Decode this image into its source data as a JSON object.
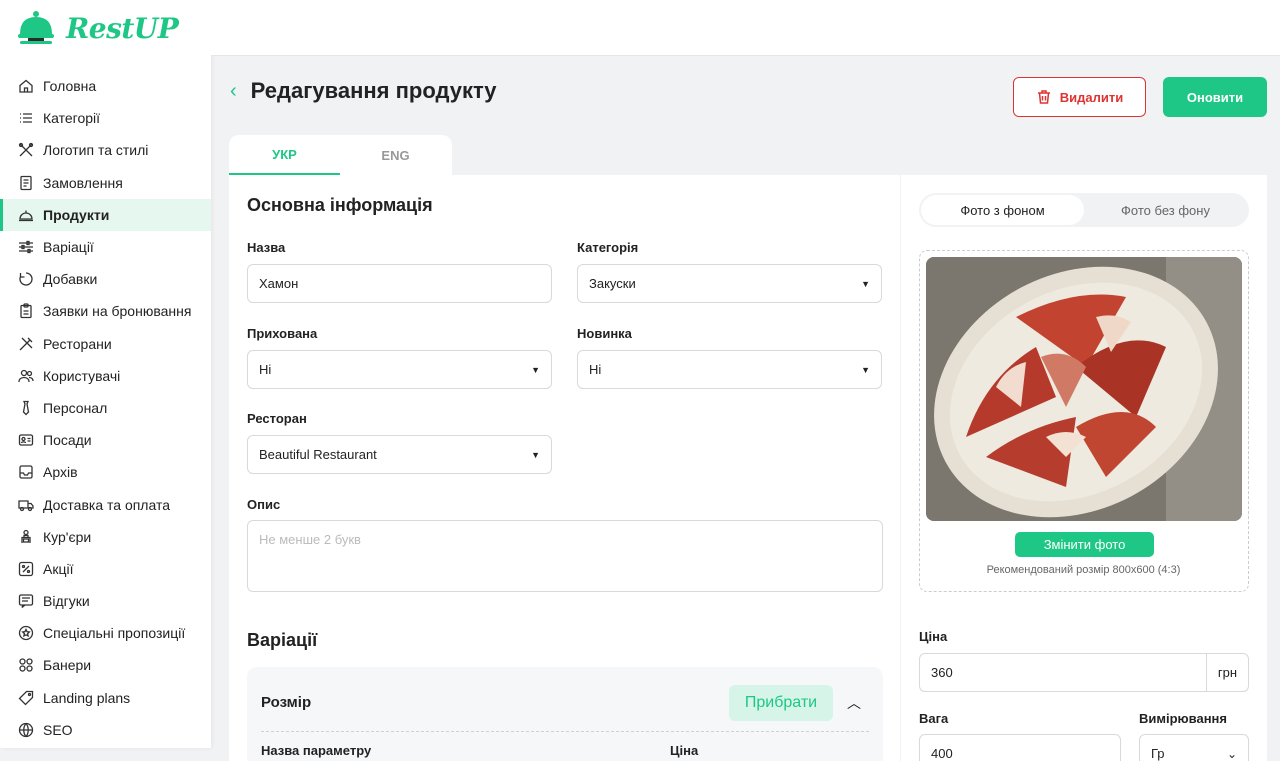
{
  "brand": {
    "name": "RestUP"
  },
  "nav": [
    {
      "label": "Головна",
      "icon": "home-icon"
    },
    {
      "label": "Категорії",
      "icon": "list-icon"
    },
    {
      "label": "Логотип та стилі",
      "icon": "brush-icon"
    },
    {
      "label": "Замовлення",
      "icon": "receipt-icon"
    },
    {
      "label": "Продукти",
      "icon": "cloche-icon",
      "active": true
    },
    {
      "label": "Варіації",
      "icon": "sliders-icon"
    },
    {
      "label": "Добавки",
      "icon": "addon-icon"
    },
    {
      "label": "Заявки на бронювання",
      "icon": "clipboard-icon"
    },
    {
      "label": "Ресторани",
      "icon": "utensils-icon"
    },
    {
      "label": "Користувачі",
      "icon": "users-icon"
    },
    {
      "label": "Персонал",
      "icon": "tie-icon"
    },
    {
      "label": "Посади",
      "icon": "id-card-icon"
    },
    {
      "label": "Архів",
      "icon": "archive-icon"
    },
    {
      "label": "Доставка та оплата",
      "icon": "truck-icon"
    },
    {
      "label": "Кур'єри",
      "icon": "courier-icon"
    },
    {
      "label": "Акції",
      "icon": "percent-icon"
    },
    {
      "label": "Відгуки",
      "icon": "chat-icon"
    },
    {
      "label": "Спеціальні пропозиції",
      "icon": "star-icon"
    },
    {
      "label": "Банери",
      "icon": "grid-icon"
    },
    {
      "label": "Landing plans",
      "icon": "tag-icon"
    },
    {
      "label": "SEO",
      "icon": "globe-icon"
    }
  ],
  "header": {
    "title": "Редагування продукту",
    "delete_label": "Видалити",
    "update_label": "Оновити"
  },
  "tabs": [
    {
      "label": "УКР",
      "active": true
    },
    {
      "label": "ENG",
      "active": false
    }
  ],
  "form": {
    "section_title": "Основна інформація",
    "name": {
      "label": "Назва",
      "value": "Хамон"
    },
    "category": {
      "label": "Категорія",
      "value": "Закуски"
    },
    "hidden": {
      "label": "Прихована",
      "value": "Ні"
    },
    "is_new": {
      "label": "Новинка",
      "value": "Ні"
    },
    "restaurant": {
      "label": "Ресторан",
      "value": "Beautiful Restaurant"
    },
    "description": {
      "label": "Опис",
      "placeholder": "Не менше 2 букв"
    }
  },
  "variations": {
    "section_title": "Варіації",
    "group_title": "Розмір",
    "remove_label": "Прибрати",
    "col_param": "Назва параметру",
    "col_price": "Ціна"
  },
  "photo": {
    "tab_with_bg": "Фото з фоном",
    "tab_without_bg": "Фото без фону",
    "change_label": "Змінити фото",
    "hint": "Рекомендований розмір 800x600 (4:3)"
  },
  "price": {
    "label": "Ціна",
    "value": "360",
    "unit": "грн"
  },
  "weight": {
    "label": "Вага",
    "value": "400"
  },
  "measure": {
    "label": "Вимірювання",
    "value": "Гр"
  },
  "colors": {
    "accent": "#1ec785",
    "danger": "#dd3333"
  }
}
